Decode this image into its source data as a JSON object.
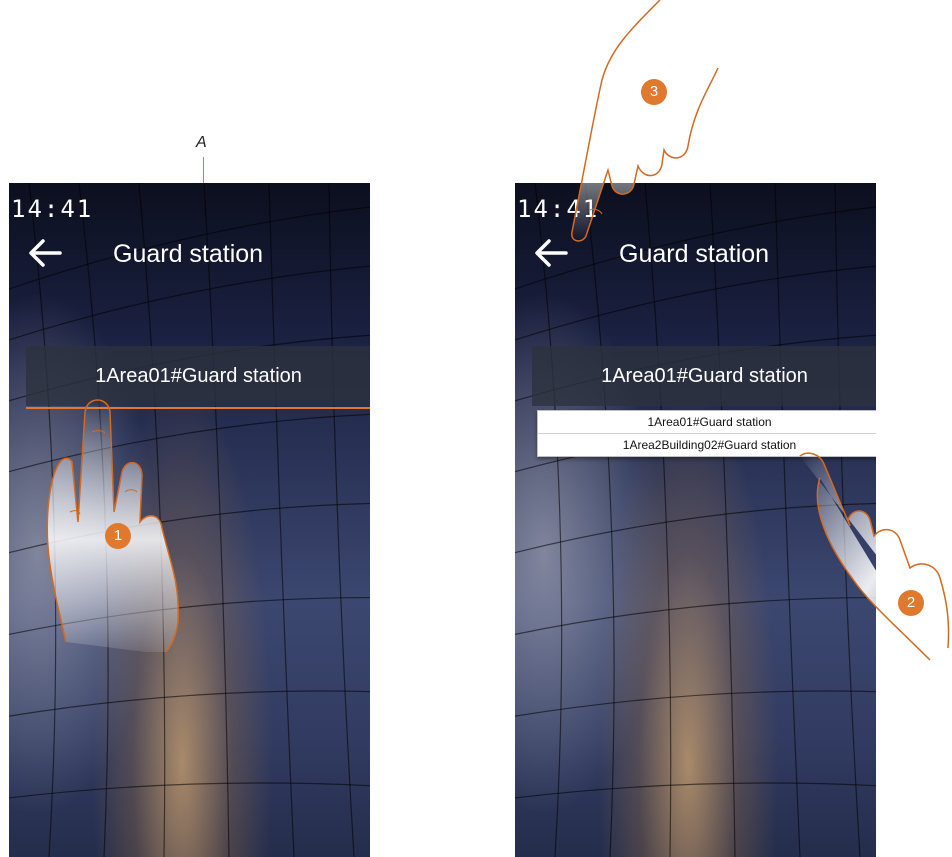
{
  "annotation": {
    "label": "A"
  },
  "steps": {
    "one": "1",
    "two": "2",
    "three": "3"
  },
  "screen_left": {
    "clock": "14:41",
    "title": "Guard station",
    "selector_value": "1Area01#Guard station"
  },
  "screen_right": {
    "clock": "14:41",
    "title": "Guard station",
    "selector_value": "1Area01#Guard station",
    "dropdown_options": [
      "1Area01#Guard station",
      "1Area2Building02#Guard station"
    ]
  },
  "colors": {
    "accent": "#e0782d",
    "hand_outline": "#d4691f"
  },
  "icons": {
    "back": "arrow-left-icon"
  }
}
